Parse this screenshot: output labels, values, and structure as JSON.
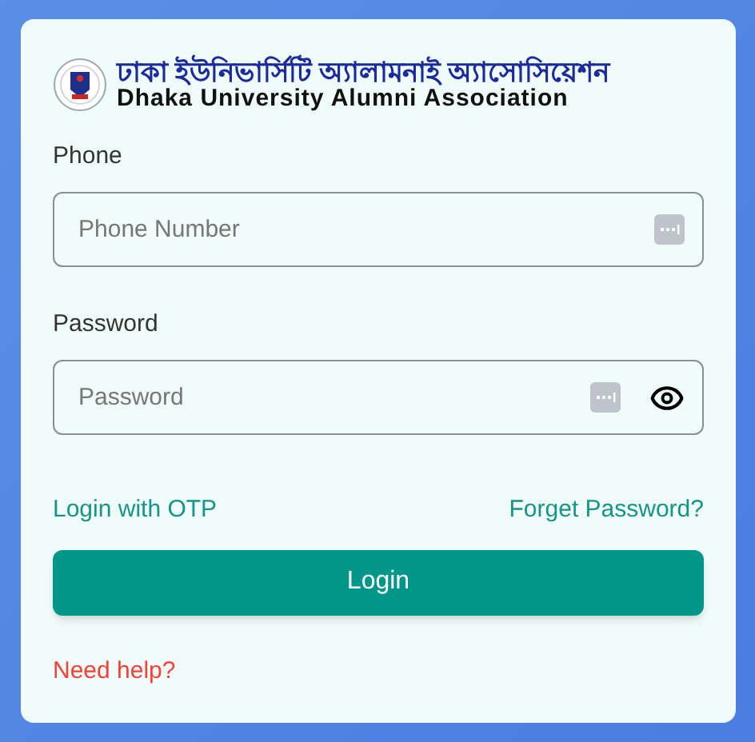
{
  "logo": {
    "title_bn": "ঢাকা ইউনিভার্সিটি অ্যালামনাই অ্যাসোসিয়েশন",
    "title_en": "Dhaka University Alumni Association"
  },
  "fields": [
    {
      "label": "Phone",
      "placeholder": "Phone Number",
      "kind": "text"
    },
    {
      "label": "Password",
      "placeholder": "Password",
      "kind": "password"
    }
  ],
  "links": {
    "otp": "Login with OTP",
    "forgot": "Forget Password?"
  },
  "login_button": "Login",
  "help_link": "Need help?"
}
